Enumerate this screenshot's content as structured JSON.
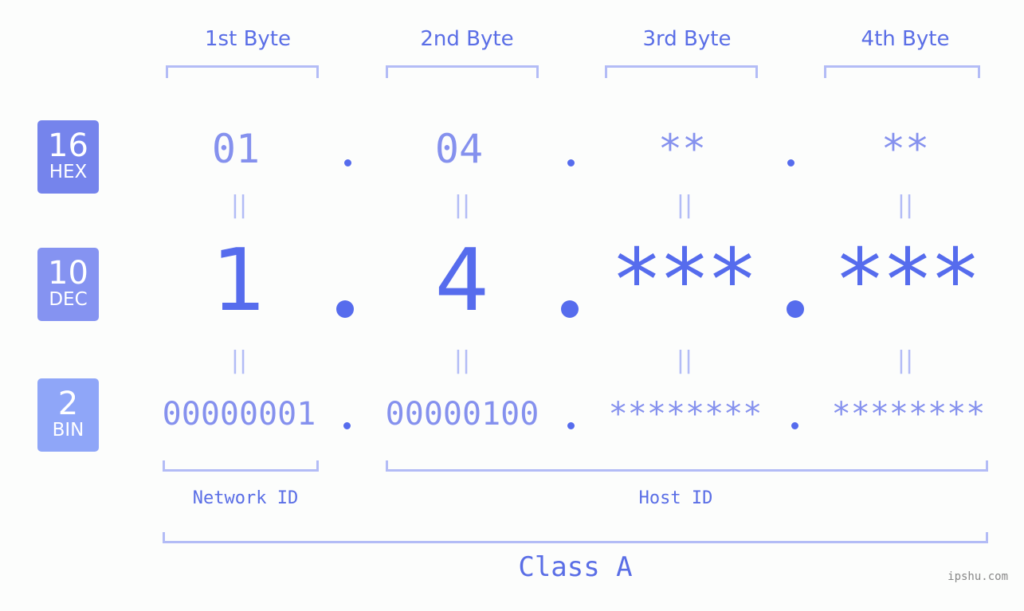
{
  "bytes": [
    {
      "header": "1st Byte",
      "hex": "01",
      "dec": "1",
      "bin": "00000001"
    },
    {
      "header": "2nd Byte",
      "hex": "04",
      "dec": "4",
      "bin": "00000100"
    },
    {
      "header": "3rd Byte",
      "hex": "**",
      "dec": "***",
      "bin": "********"
    },
    {
      "header": "4th Byte",
      "hex": "**",
      "dec": "***",
      "bin": "********"
    }
  ],
  "badges": {
    "hex": {
      "number": "16",
      "label": "HEX",
      "color": "#7584ec"
    },
    "dec": {
      "number": "10",
      "label": "DEC",
      "color": "#8593f1"
    },
    "bin": {
      "number": "2",
      "label": "BIN",
      "color": "#8fa6f8"
    }
  },
  "equals_symbol": "||",
  "network_label": "Network ID",
  "host_label": "Host ID",
  "class_label": "Class A",
  "watermark": "ipshu.com",
  "colors": {
    "accent": "#566ced",
    "muted": "#8591ee",
    "bracket": "#b3bcf6"
  }
}
